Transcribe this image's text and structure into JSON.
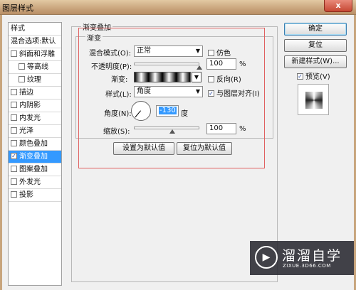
{
  "window": {
    "title": "图层样式",
    "close_label": "x"
  },
  "styles_list": {
    "header": "样式",
    "blend_default": "混合选项:默认",
    "items": [
      {
        "label": "斜面和浮雕",
        "checked": false,
        "indent": false
      },
      {
        "label": "等高线",
        "checked": false,
        "indent": true
      },
      {
        "label": "纹理",
        "checked": false,
        "indent": true
      },
      {
        "label": "描边",
        "checked": false,
        "indent": false
      },
      {
        "label": "内阴影",
        "checked": false,
        "indent": false
      },
      {
        "label": "内发光",
        "checked": false,
        "indent": false
      },
      {
        "label": "光泽",
        "checked": false,
        "indent": false
      },
      {
        "label": "颜色叠加",
        "checked": false,
        "indent": false
      },
      {
        "label": "渐变叠加",
        "checked": true,
        "indent": false,
        "selected": true
      },
      {
        "label": "图案叠加",
        "checked": false,
        "indent": false
      },
      {
        "label": "外发光",
        "checked": false,
        "indent": false
      },
      {
        "label": "投影",
        "checked": false,
        "indent": false
      }
    ]
  },
  "panel": {
    "outer_title": "渐变叠加",
    "inner_title": "渐变",
    "blend_mode_label": "混合模式(O):",
    "blend_mode_value": "正常",
    "dither_label": "仿色",
    "opacity_label": "不透明度(P):",
    "opacity_value": "100",
    "opacity_unit": "%",
    "opacity_level": 1.0,
    "gradient_label": "渐变:",
    "reverse_label": "反向(R)",
    "style_label": "样式(L):",
    "style_value": "角度",
    "align_label": "与图层对齐(I)",
    "angle_label": "角度(N):",
    "angle_value": "-130",
    "angle_unit": "度",
    "scale_label": "缩放(S):",
    "scale_value": "100",
    "scale_unit": "%",
    "scale_level": 0.5,
    "make_default": "设置为默认值",
    "reset_default": "复位为默认值"
  },
  "buttons": {
    "ok": "确定",
    "reset": "复位",
    "new_style": "新建样式(W)...",
    "preview": "预览(V)"
  },
  "watermark": {
    "name": "溜溜自学",
    "url": "ZIXUE.3D66.COM"
  }
}
